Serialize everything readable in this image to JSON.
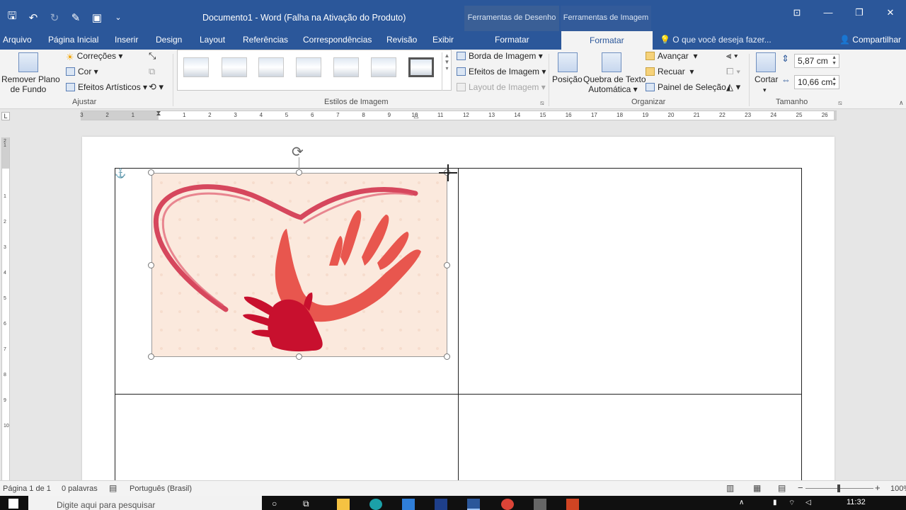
{
  "window": {
    "title": "Documento1 - Word (Falha na Ativação do Produto)",
    "context_draw": "Ferramentas de Desenho",
    "context_image": "Ferramentas de Imagem"
  },
  "qat": {
    "save": "🖫",
    "undo": "↶",
    "redo": "↻",
    "extra1": "✎",
    "extra2": "▣",
    "more": "⌄"
  },
  "winctrl": {
    "ribbon_opts": "⊡",
    "minimize": "—",
    "restore": "❐",
    "close": "✕"
  },
  "tabs": [
    {
      "label": "Arquivo"
    },
    {
      "label": "Página Inicial"
    },
    {
      "label": "Inserir"
    },
    {
      "label": "Design"
    },
    {
      "label": "Layout"
    },
    {
      "label": "Referências"
    },
    {
      "label": "Correspondências"
    },
    {
      "label": "Revisão"
    },
    {
      "label": "Exibir"
    },
    {
      "label": "Formatar"
    },
    {
      "label": "Formatar"
    }
  ],
  "tell_me": "O que você deseja fazer...",
  "share": "Compartilhar",
  "ribbon": {
    "remove_bg_line1": "Remover Plano",
    "remove_bg_line2": "de Fundo",
    "corrections": "Correções",
    "color": "Cor",
    "artistic": "Efeitos Artísticos",
    "group_adjust": "Ajustar",
    "group_styles": "Estilos de Imagem",
    "picture_border": "Borda de Imagem",
    "picture_effects": "Efeitos de Imagem",
    "picture_layout": "Layout de Imagem",
    "position": "Posição",
    "wrap_line1": "Quebra de Texto",
    "wrap_line2": "Automática",
    "bring_forward": "Avançar",
    "send_backward": "Recuar",
    "selection_pane": "Painel de Seleção",
    "group_arrange": "Organizar",
    "crop": "Cortar",
    "height": "5,87 cm",
    "width": "10,66 cm",
    "group_size": "Tamanho"
  },
  "ruler": {
    "tab_selector": "L",
    "h_numbers": [
      "3",
      "2",
      "1",
      "1",
      "2",
      "3",
      "4",
      "5",
      "6",
      "7",
      "8",
      "9",
      "10",
      "11",
      "12",
      "13",
      "14",
      "15",
      "16",
      "17",
      "18",
      "19",
      "20",
      "21",
      "22",
      "23",
      "24",
      "25",
      "26"
    ],
    "v_numbers": [
      "2",
      "1",
      "1",
      "2",
      "3",
      "4",
      "5",
      "6",
      "7",
      "8",
      "9",
      "10"
    ]
  },
  "document": {
    "anchor": "⚓",
    "rotate": "⟳"
  },
  "status": {
    "page": "Página 1 de 1",
    "words": "0 palavras",
    "language": "Português (Brasil)",
    "zoom_minus": "−",
    "zoom_plus": "+",
    "zoom": "100%"
  },
  "taskbar": {
    "search": "Digite aqui para pesquisar",
    "time": "11:32"
  },
  "colors": {
    "accent": "#2b579a",
    "heart": "#d2354f",
    "hand": "#e8564e"
  }
}
